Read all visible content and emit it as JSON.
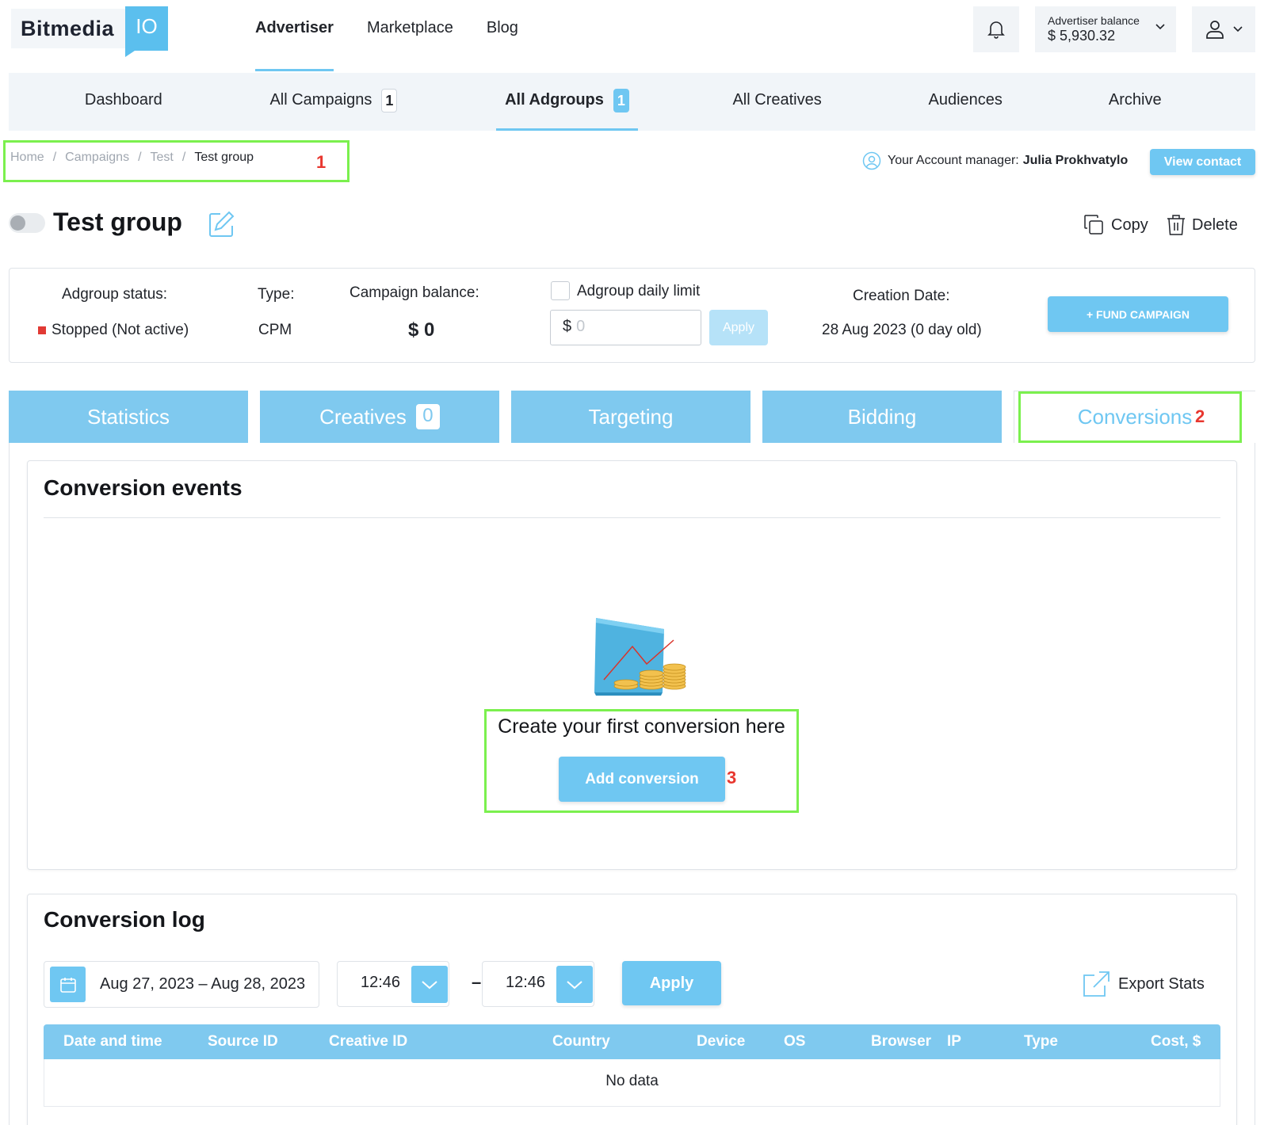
{
  "brand": {
    "name": "Bitmedia",
    "suffix": "IO"
  },
  "topnav": {
    "items": [
      "Advertiser",
      "Marketplace",
      "Blog"
    ],
    "active": "Advertiser"
  },
  "balance": {
    "label": "Advertiser balance",
    "value": "$ 5,930.32"
  },
  "subnav": {
    "items": [
      {
        "label": "Dashboard",
        "badge": null
      },
      {
        "label": "All Campaigns",
        "badge": "1"
      },
      {
        "label": "All Adgroups",
        "badge": "1"
      },
      {
        "label": "All Creatives",
        "badge": null
      },
      {
        "label": "Audiences",
        "badge": null
      },
      {
        "label": "Archive",
        "badge": null
      }
    ],
    "active": "All Adgroups"
  },
  "breadcrumb": {
    "items": [
      "Home",
      "Campaigns",
      "Test",
      "Test group"
    ],
    "separator": "/"
  },
  "annotations": [
    "1",
    "2",
    "3"
  ],
  "manager": {
    "prefix": "Your Account manager:",
    "name": "Julia Prokhvatylo",
    "button": "View contact"
  },
  "page": {
    "title": "Test group",
    "copy": "Copy",
    "delete": "Delete"
  },
  "info": {
    "status_label": "Adgroup status:",
    "status_value": "Stopped (Not active)",
    "type_label": "Type:",
    "type_value": "CPM",
    "balance_label": "Campaign balance:",
    "balance_value": "$ 0",
    "limit_label": "Adgroup daily limit",
    "limit_prefix": "$",
    "limit_placeholder": "0",
    "limit_apply": "Apply",
    "creation_label": "Creation Date:",
    "creation_value": "28 Aug 2023 (0 day old)",
    "fund_button": "+ FUND CAMPAIGN"
  },
  "tabs": [
    {
      "label": "Statistics",
      "badge": null
    },
    {
      "label": "Creatives",
      "badge": "0"
    },
    {
      "label": "Targeting",
      "badge": null
    },
    {
      "label": "Bidding",
      "badge": null
    },
    {
      "label": "Conversions",
      "badge": null
    }
  ],
  "active_tab": "Conversions",
  "conversion_events": {
    "title": "Conversion events",
    "empty_text": "Create your first conversion here",
    "add_button": "Add conversion"
  },
  "conversion_log": {
    "title": "Conversion log",
    "date_range": "Aug 27, 2023 – Aug 28, 2023",
    "time_from": "12:46",
    "time_to": "12:46",
    "time_separator": "–",
    "apply": "Apply",
    "export": "Export Stats",
    "columns": [
      "Date and time",
      "Source ID",
      "Creative ID",
      "Country",
      "Device",
      "OS",
      "Browser",
      "IP",
      "Type",
      "Cost, $"
    ],
    "empty": "No data"
  },
  "colors": {
    "accent": "#6fc7f2",
    "tab": "#7fc9ef",
    "highlight": "#7bf04e",
    "annotation": "#e8372f",
    "stopped": "#e13a34"
  }
}
